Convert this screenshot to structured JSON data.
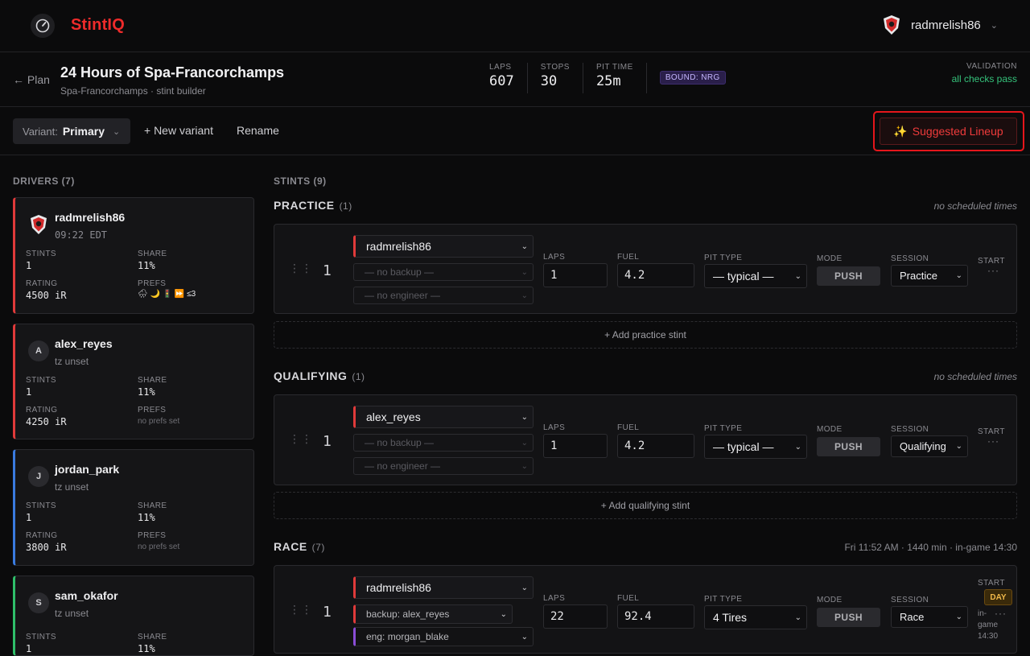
{
  "app": {
    "brand": "StintIQ",
    "user": "radmrelish86"
  },
  "event": {
    "back_label": "← Plan",
    "title": "24 Hours of Spa-Francorchamps",
    "subtitle": "Spa-Francorchamps · stint builder",
    "stats": [
      {
        "label": "LAPS",
        "value": "607"
      },
      {
        "label": "STOPS",
        "value": "30"
      },
      {
        "label": "PIT TIME",
        "value": "25m"
      }
    ],
    "bound": "BOUND: NRG",
    "validation_label": "VALIDATION",
    "validation_value": "all checks pass"
  },
  "toolbar": {
    "variant_label": "Variant:",
    "variant_value": "Primary",
    "new_variant": "+ New variant",
    "rename": "Rename",
    "suggested": "Suggested Lineup",
    "suggested_icon": "✨"
  },
  "drivers_header": "DRIVERS (7)",
  "drivers": [
    {
      "name": "radmrelish86",
      "tz": "09:22 EDT",
      "stints": "1",
      "share": "11%",
      "rating": "4500 iR",
      "prefs": "🌧 🌙 🚦 ⏩ ≤3",
      "color": "#e03a3a",
      "initial": ""
    },
    {
      "name": "alex_reyes",
      "tz": "tz unset",
      "stints": "1",
      "share": "11%",
      "rating": "4250 iR",
      "prefs": "no prefs set",
      "color": "#e03a3a",
      "initial": "A"
    },
    {
      "name": "jordan_park",
      "tz": "tz unset",
      "stints": "1",
      "share": "11%",
      "rating": "3800 iR",
      "prefs": "no prefs set",
      "color": "#3a7be0",
      "initial": "J"
    },
    {
      "name": "sam_okafor",
      "tz": "tz unset",
      "stints": "1",
      "share": "11%",
      "color": "#2fbf6a",
      "initial": "S"
    }
  ],
  "labels": {
    "stints": "STINTS",
    "share": "SHARE",
    "rating": "RATING",
    "prefs": "PREFS",
    "laps": "LAPS",
    "fuel": "FUEL",
    "pit_type": "PIT TYPE",
    "mode": "MODE",
    "session": "SESSION",
    "start": "START"
  },
  "stints_header": "STINTS (9)",
  "sections": {
    "practice": {
      "title": "PRACTICE",
      "count": "(1)",
      "right": "no scheduled times",
      "add": "+ Add practice stint"
    },
    "qualifying": {
      "title": "QUALIFYING",
      "count": "(1)",
      "right": "no scheduled times",
      "add": "+ Add qualifying stint"
    },
    "race": {
      "title": "RACE",
      "count": "(7)",
      "right": "Fri 11:52 AM  · 1440 min  · in-game 14:30"
    }
  },
  "stints": {
    "practice": {
      "num": "1",
      "driver": "radmrelish86",
      "backup": "— no backup —",
      "engineer": "— no engineer —",
      "laps": "1",
      "fuel": "4.2",
      "pit": "— typical —",
      "mode": "PUSH",
      "session": "Practice",
      "more": "···"
    },
    "qualifying": {
      "num": "1",
      "driver": "alex_reyes",
      "backup": "— no backup —",
      "engineer": "— no engineer —",
      "laps": "1",
      "fuel": "4.2",
      "pit": "— typical —",
      "mode": "PUSH",
      "session": "Qualifying",
      "more": "···"
    },
    "race": {
      "num": "1",
      "driver": "radmrelish86",
      "backup": "backup: alex_reyes",
      "engineer": "eng: morgan_blake",
      "laps": "22",
      "fuel": "92.4",
      "pit": "4 Tires",
      "mode": "PUSH",
      "session": "Race",
      "day": "DAY",
      "ingame": "in-game 14:30",
      "more": "···"
    }
  }
}
